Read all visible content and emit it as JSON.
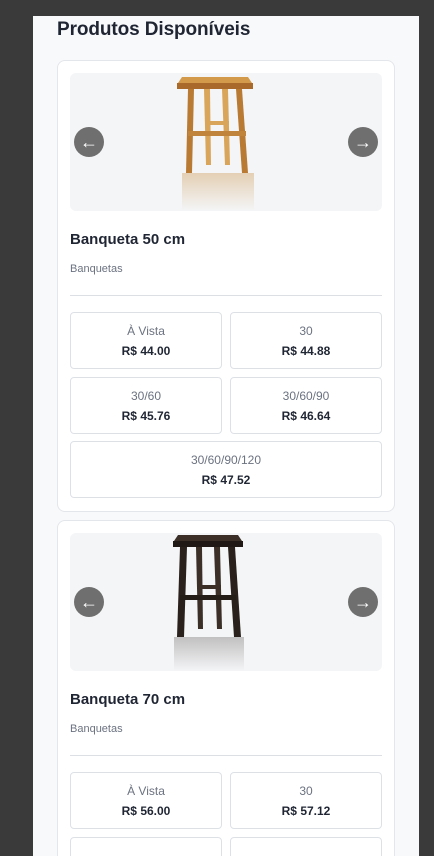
{
  "page": {
    "title": "Produtos Disponíveis"
  },
  "icons": {
    "prev": "←",
    "next": "→"
  },
  "colors": {
    "wood_light": "#c58a38",
    "wood_dark": "#2a211c"
  },
  "products": [
    {
      "name": "Banqueta 50 cm",
      "category": "Banquetas",
      "image": "light-wood-stool",
      "prices": [
        {
          "label": "À Vista",
          "value": "R$ 44.00"
        },
        {
          "label": "30",
          "value": "R$ 44.88"
        },
        {
          "label": "30/60",
          "value": "R$ 45.76"
        },
        {
          "label": "30/60/90",
          "value": "R$ 46.64"
        },
        {
          "label": "30/60/90/120",
          "value": "R$ 47.52"
        }
      ]
    },
    {
      "name": "Banqueta 70 cm",
      "category": "Banquetas",
      "image": "dark-wood-stool",
      "prices": [
        {
          "label": "À Vista",
          "value": "R$ 56.00"
        },
        {
          "label": "30",
          "value": "R$ 57.12"
        }
      ]
    }
  ]
}
